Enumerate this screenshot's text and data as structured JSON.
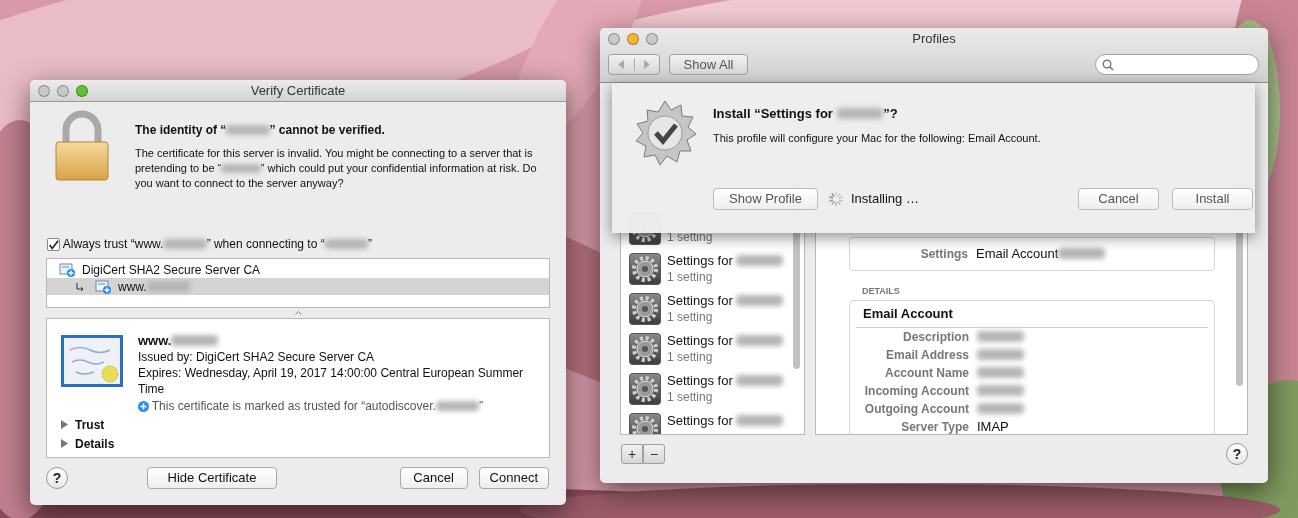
{
  "verify_window": {
    "title": "Verify Certificate",
    "heading": [
      "The identity of “",
      {
        "kind": "blurred"
      },
      "” cannot be verified."
    ],
    "message": [
      "The certificate for this server is invalid. You might be connecting to a server that is pretending to be “",
      {
        "kind": "blurred"
      },
      "” which could put your confidential information at risk. Do you want to connect to the server anyway?"
    ],
    "always_trust": {
      "label": [
        "Always trust “www.",
        {
          "kind": "blurred"
        },
        "” when connecting to “",
        {
          "kind": "blurred"
        },
        "”"
      ],
      "checked": true
    },
    "chain": [
      {
        "name": [
          "DigiCert SHA2 Secure Server CA"
        ],
        "selected": false,
        "children": [
          {
            "name": [
              "www.",
              {
                "kind": "blurred"
              }
            ],
            "selected": true
          }
        ]
      }
    ],
    "certificate": {
      "name": [
        "www.",
        {
          "kind": "blurred"
        }
      ],
      "issued_by": "Issued by: DigiCert SHA2 Secure Server CA",
      "expires": "Expires: Wednesday, April 19, 2017 14:00:00 Central European Summer Time",
      "trust_note": [
        "This certificate is marked as trusted for “autodiscover.",
        {
          "kind": "blurred"
        },
        "”"
      ]
    },
    "sections": [
      {
        "label": "Trust",
        "expanded": false
      },
      {
        "label": "Details",
        "expanded": false
      }
    ],
    "help": "?",
    "buttons": [
      "Hide Certificate",
      "Cancel",
      "Connect"
    ]
  },
  "profiles_window": {
    "title": "Profiles",
    "show_all": "Show All",
    "install_sheet": {
      "title": [
        "Install “Settings for ",
        {
          "kind": "blurred"
        },
        "”?"
      ],
      "message": "This profile will configure your Mac for the following: Email Account.",
      "status": "Installing …",
      "buttons": [
        "Show Profile",
        "Cancel",
        "Install"
      ]
    },
    "profiles": [
      {
        "subtitle": "1 setting"
      },
      {
        "title": [
          "Settings for ",
          {
            "kind": "blurred"
          }
        ],
        "subtitle": "1 setting"
      },
      {
        "title": [
          "Settings for ",
          {
            "kind": "blurred"
          }
        ],
        "subtitle": "1 setting"
      },
      {
        "title": [
          "Settings for ",
          {
            "kind": "blurred"
          }
        ],
        "subtitle": "1 setting"
      },
      {
        "title": [
          "Settings for ",
          {
            "kind": "blurred"
          }
        ],
        "subtitle": "1 setting"
      },
      {
        "title": [
          "Settings for ",
          {
            "kind": "blurred"
          }
        ]
      }
    ],
    "settings_summary": {
      "label": "Settings",
      "value": [
        "Email Account",
        {
          "kind": "blurred"
        }
      ]
    },
    "details_heading": "DETAILS",
    "details": {
      "title": "Email Account",
      "rows": [
        {
          "label": "Description",
          "value": [
            {
              "kind": "blurred"
            }
          ]
        },
        {
          "label": "Email Address",
          "value": [
            {
              "kind": "blurred"
            }
          ]
        },
        {
          "label": "Account Name",
          "value": [
            {
              "kind": "blurred"
            }
          ]
        },
        {
          "label": "Incoming Account",
          "value": [
            {
              "kind": "blurred"
            }
          ]
        },
        {
          "label": "Outgoing Account",
          "value": [
            {
              "kind": "blurred"
            }
          ]
        },
        {
          "label": "Server Type",
          "value": [
            "IMAP"
          ]
        }
      ]
    },
    "list_buttons": [
      "+",
      "−"
    ],
    "help": "?"
  }
}
